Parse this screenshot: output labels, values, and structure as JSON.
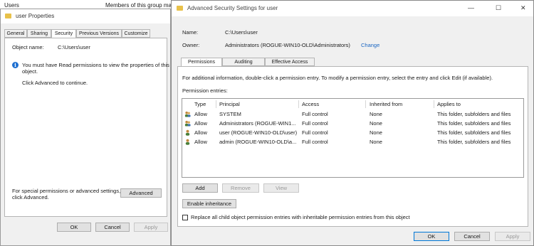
{
  "background": {
    "col_users": "Users",
    "col_members": "Members of this group ma"
  },
  "left_dialog": {
    "title": "user Properties",
    "tabs": [
      "General",
      "Sharing",
      "Security",
      "Previous Versions",
      "Customize"
    ],
    "active_tab": "Security",
    "object_name_label": "Object name:",
    "object_name_value": "C:\\Users\\user",
    "info_text_line1": "You must have Read permissions to view the properties of this",
    "info_text_line2": "object.",
    "advanced_hint": "Click Advanced to continue.",
    "special_text_line1": "For special permissions or advanced settings,",
    "special_text_line2": "click Advanced.",
    "advanced_button": "Advanced",
    "ok_button": "OK",
    "cancel_button": "Cancel",
    "apply_button": "Apply"
  },
  "right_dialog": {
    "title": "Advanced Security Settings for user",
    "name_label": "Name:",
    "name_value": "C:\\Users\\user",
    "owner_label": "Owner:",
    "owner_value": "Administrators (ROGUE-WIN10-OLD\\Administrators)",
    "change_link": "Change",
    "tabs": [
      "Permissions",
      "Auditing",
      "Effective Access"
    ],
    "active_tab": "Permissions",
    "info_text": "For additional information, double-click a permission entry. To modify a permission entry, select the entry and click Edit (if available).",
    "entries_label": "Permission entries:",
    "columns": [
      "Type",
      "Principal",
      "Access",
      "Inherited from",
      "Applies to"
    ],
    "rows": [
      {
        "icon": "group-icon",
        "type": "Allow",
        "principal": "SYSTEM",
        "access": "Full control",
        "inherited": "None",
        "applies": "This folder, subfolders and files"
      },
      {
        "icon": "group-icon",
        "type": "Allow",
        "principal": "Administrators (ROGUE-WIN1...",
        "access": "Full control",
        "inherited": "None",
        "applies": "This folder, subfolders and files"
      },
      {
        "icon": "user-icon",
        "type": "Allow",
        "principal": "user (ROGUE-WIN10-OLD\\user)",
        "access": "Full control",
        "inherited": "None",
        "applies": "This folder, subfolders and files"
      },
      {
        "icon": "user-icon",
        "type": "Allow",
        "principal": "admin (ROGUE-WIN10-OLD\\a...",
        "access": "Full control",
        "inherited": "None",
        "applies": "This folder, subfolders and files"
      }
    ],
    "add_button": "Add",
    "remove_button": "Remove",
    "view_button": "View",
    "enable_inheritance_button": "Enable inheritance",
    "replace_checkbox_label": "Replace all child object permission entries with inheritable permission entries from this object",
    "replace_checked": false,
    "ok_button": "OK",
    "cancel_button": "Cancel",
    "apply_button": "Apply",
    "minimize_glyph": "—",
    "maximize_glyph": "☐",
    "close_glyph": "✕"
  },
  "colors": {
    "link": "#1a66c2",
    "folder": "#e8c14a",
    "info": "#1e6fd0",
    "focus_border": "#0078d7"
  }
}
